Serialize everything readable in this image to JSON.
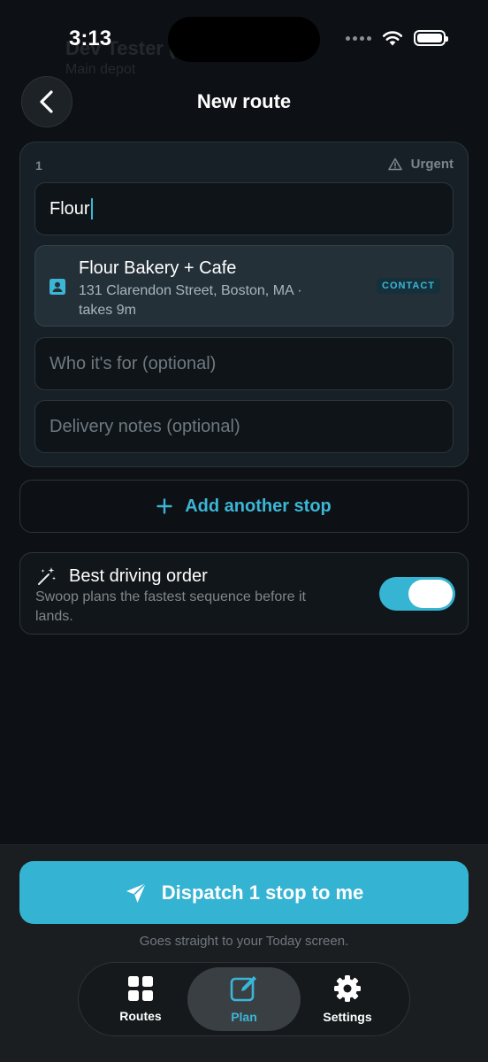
{
  "background": {
    "ghost_title": "Dev Tester (",
    "ghost_subtitle": "Main depot"
  },
  "status_bar": {
    "time": "3:13"
  },
  "header": {
    "title": "New route"
  },
  "stop": {
    "number": "1",
    "urgent_label": "Urgent",
    "search_value": "Flour",
    "suggestion": {
      "name": "Flour Bakery + Cafe",
      "address": "131 Clarendon Street, Boston, MA · takes 9m",
      "badge": "CONTACT"
    },
    "recipient_placeholder": "Who it's for (optional)",
    "notes_placeholder": "Delivery notes (optional)"
  },
  "add_stop": {
    "label": "Add another stop"
  },
  "driving_order": {
    "title": "Best driving order",
    "description": "Swoop plans the fastest sequence before it lands.",
    "enabled": true
  },
  "dispatch": {
    "label": "Dispatch 1 stop to me",
    "note": "Goes straight to your Today screen."
  },
  "tabbar": {
    "routes": "Routes",
    "plan": "Plan",
    "settings": "Settings"
  },
  "colors": {
    "accent": "#36b4d3",
    "background": "#0d1014",
    "card": "#172026"
  }
}
